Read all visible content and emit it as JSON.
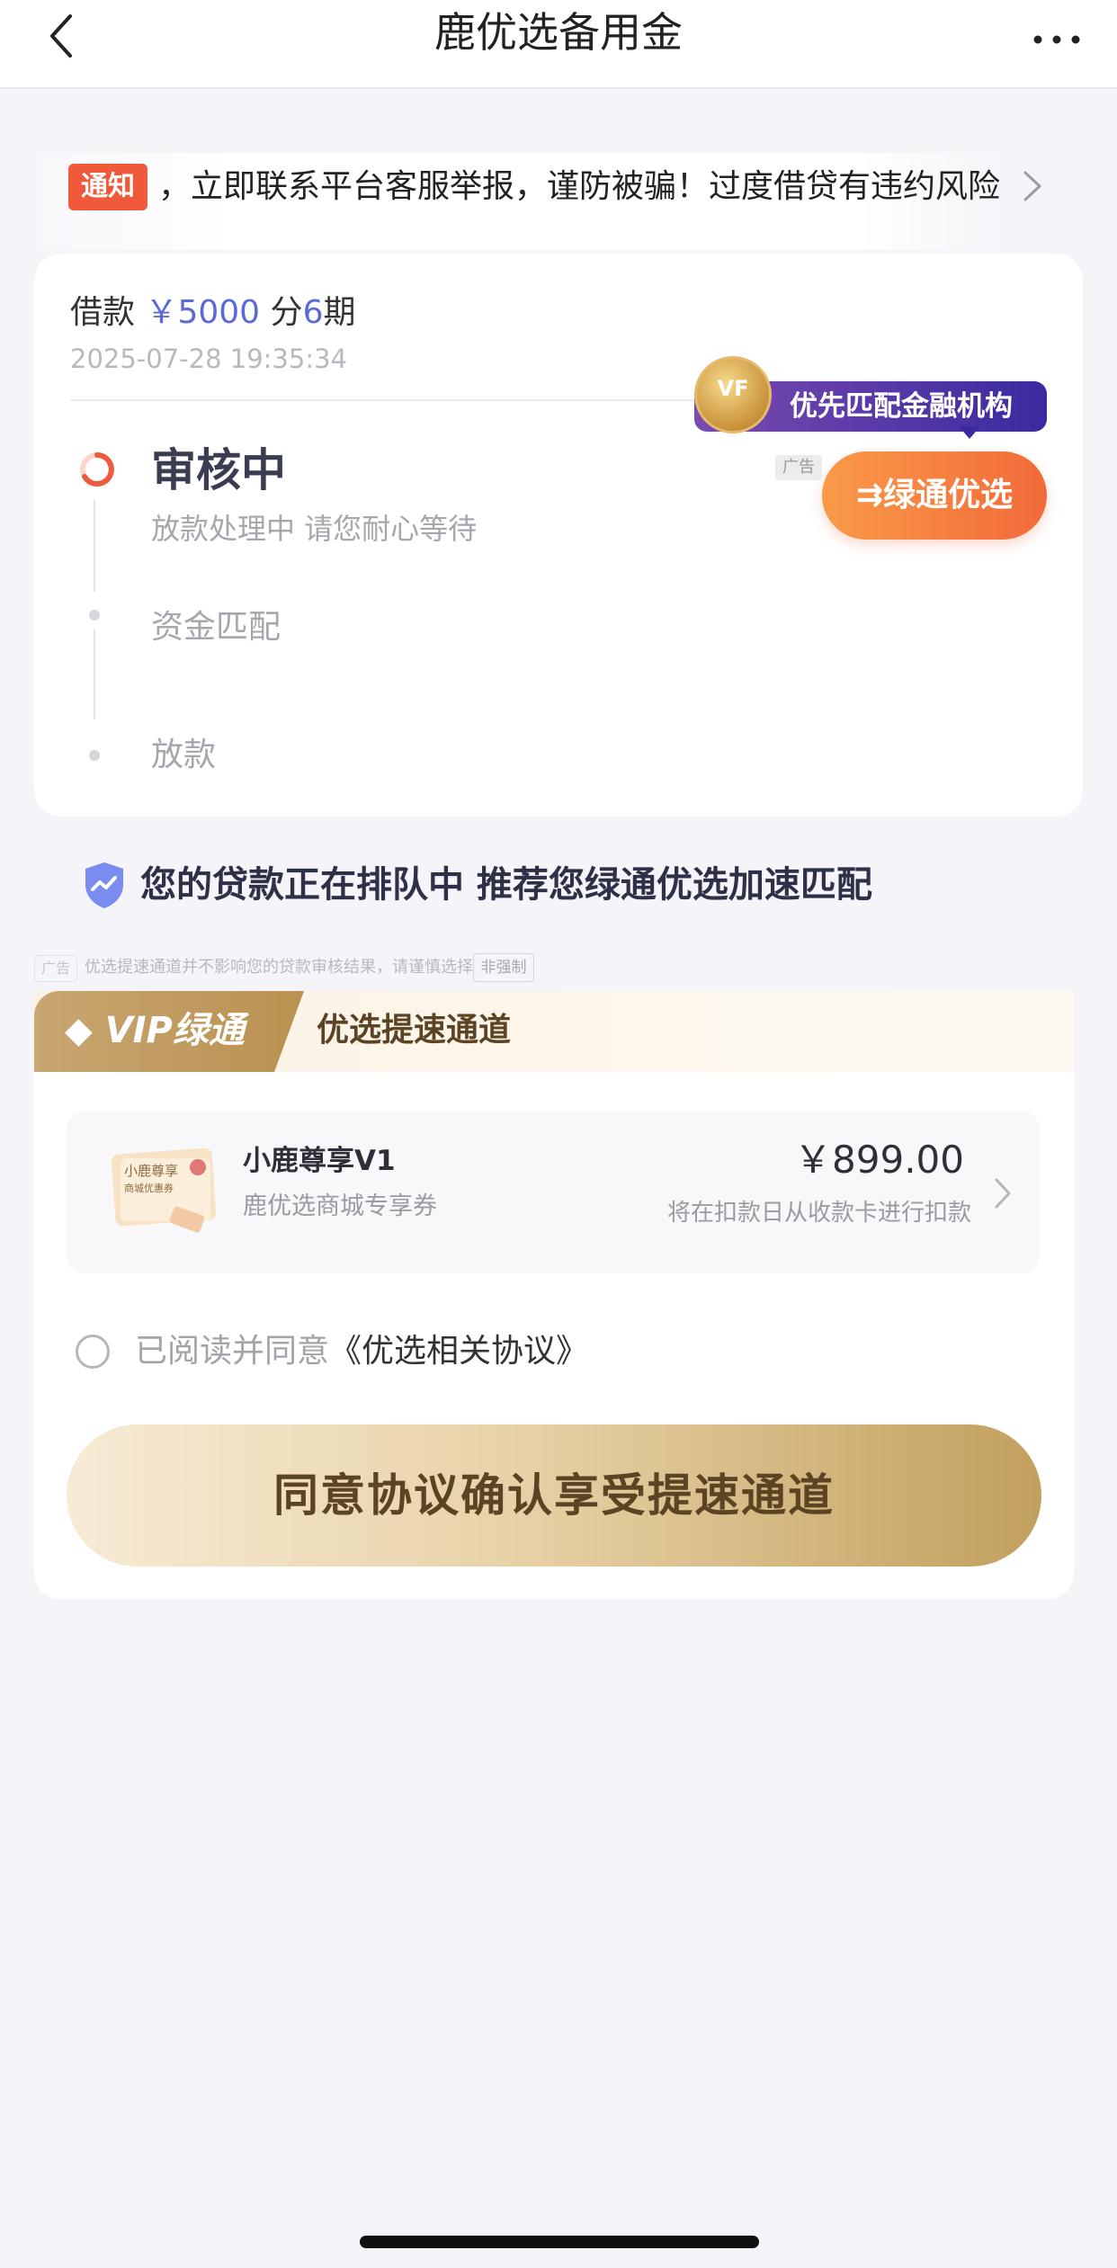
{
  "header": {
    "title": "鹿优选备用金",
    "back_icon": "chevron-left-icon",
    "more_icon": "more-dots-icon"
  },
  "notice": {
    "badge": "通知",
    "text": "立即联系平台客服举报，谨防被骗！过度借贷有违约风险，",
    "arrow_icon": "chevron-right-icon"
  },
  "loan": {
    "prefix": "借款",
    "amount": "￥5000",
    "installment_prefix": "分",
    "installments": "6",
    "installment_suffix": "期",
    "datetime": "2025-07-28 19:35:34"
  },
  "promo": {
    "medal_text": "VF",
    "priority_text": "优先匹配金融机构",
    "ad_label": "广告",
    "button_label": "⇉绿通优选"
  },
  "steps": [
    {
      "title": "审核中",
      "subtitle": "放款处理中 请您耐心等待",
      "state": "active"
    },
    {
      "title": "资金匹配",
      "state": "pending"
    },
    {
      "title": "放款",
      "state": "pending"
    }
  ],
  "queue_message": "您的贷款正在排队中 推荐您绿通优选加速匹配",
  "disclaimer": {
    "ad_label": "广告",
    "text": "优选提速通道并不影响您的贷款审核结果，请谨慎选择",
    "tag": "非强制"
  },
  "vip": {
    "left_label": "VIP绿通",
    "right_label": "优选提速通道"
  },
  "product": {
    "coupon_lines": [
      "小鹿尊享",
      "商城优惠券"
    ],
    "name": "小鹿尊享V1",
    "subtitle": "鹿优选商城专享券",
    "price": "￥899.00",
    "note": "将在扣款日从收款卡进行扣款"
  },
  "agreement": {
    "prefix": "已阅读并同意",
    "link": "《优选相关协议》",
    "checked": false
  },
  "confirm_button": "同意协议确认享受提速通道",
  "colors": {
    "accent_blue": "#5b6ad8",
    "orange": "#f26a3a",
    "gold": "#c2a05e",
    "notice_red": "#f05a3a"
  }
}
